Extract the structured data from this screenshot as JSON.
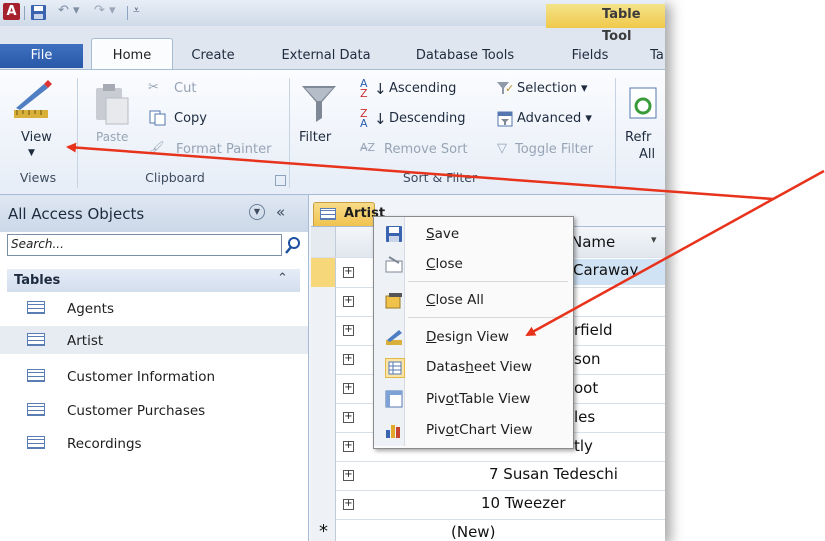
{
  "titlebar": {
    "app_logo": "A",
    "contextual_tab": "Table Tool",
    "icons": {
      "save": "save-icon",
      "undo": "undo-icon",
      "redo": "redo-icon",
      "customize": "customize-qat-icon"
    }
  },
  "tabs": [
    {
      "label": "File"
    },
    {
      "label": "Home"
    },
    {
      "label": "Create"
    },
    {
      "label": "External Data"
    },
    {
      "label": "Database Tools"
    },
    {
      "label": "Fields"
    },
    {
      "label": "Ta"
    }
  ],
  "ribbon": {
    "views": {
      "view_label": "View",
      "group_label": "Views"
    },
    "clipboard": {
      "paste_label": "Paste",
      "cut_label": "Cut",
      "copy_label": "Copy",
      "format_painter_label": "Format Painter",
      "group_label": "Clipboard"
    },
    "sort_filter": {
      "filter_label": "Filter",
      "ascending_label": "Ascending",
      "descending_label": "Descending",
      "remove_sort_label": "Remove Sort",
      "selection_label": "Selection ▾",
      "advanced_label": "Advanced ▾",
      "toggle_filter_label": "Toggle Filter",
      "group_label": "Sort & Filter"
    },
    "records": {
      "refresh_label_1": "Refr",
      "refresh_label_2": "All"
    }
  },
  "nav": {
    "title": "All Access Objects",
    "search_placeholder": "Search...",
    "section_label": "Tables",
    "items": [
      {
        "label": "Agents"
      },
      {
        "label": "Artist"
      },
      {
        "label": "Customer Information"
      },
      {
        "label": "Customer Purchases"
      },
      {
        "label": "Recordings"
      }
    ]
  },
  "document": {
    "tab_label": "Artist",
    "column_header": "Name",
    "rows": [
      {
        "text": "Caraway"
      },
      {
        "text": ""
      },
      {
        "text": "rfield"
      },
      {
        "text": "son"
      },
      {
        "text": "oot"
      },
      {
        "text": "les"
      },
      {
        "text": "tly"
      },
      {
        "text": "7 Susan Tedeschi"
      },
      {
        "text": "10 Tweezer"
      }
    ],
    "new_row_marker": "*",
    "new_row_label": "(New)"
  },
  "context_menu": {
    "items": [
      {
        "label": "Save",
        "icon": "save-icon"
      },
      {
        "label": "Close",
        "icon": "close-document-icon"
      },
      {
        "label": "Close All",
        "icon": "close-all-icon"
      },
      {
        "label": "Design View",
        "icon": "design-view-icon"
      },
      {
        "label": "Datasheet View",
        "icon": "datasheet-view-icon"
      },
      {
        "label": "PivotTable View",
        "icon": "pivottable-view-icon"
      },
      {
        "label": "PivotChart View",
        "icon": "pivotchart-view-icon"
      }
    ]
  },
  "colors": {
    "arrow": "#e8331c",
    "file_tab": "#2f62b4",
    "contextual": "#f0c94a"
  }
}
